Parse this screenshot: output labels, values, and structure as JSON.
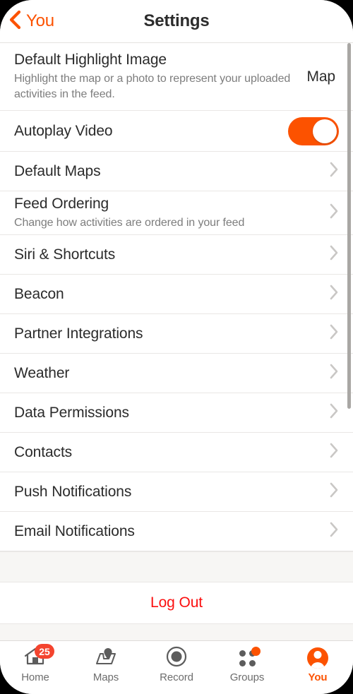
{
  "navbar": {
    "back_label": "You",
    "back_icon": "chevron-left-icon",
    "title": "Settings"
  },
  "colors": {
    "accent_orange": "#fc5200",
    "logout_red": "#fb0f0f",
    "badge_red": "#f4442e",
    "spacer_gray": "#f7f6f4",
    "chevron_gray": "#c9c7c5"
  },
  "settings": {
    "highlight_image": {
      "title": "Default Highlight Image",
      "subtitle": "Highlight the map or a photo to represent your uploaded activities in the feed.",
      "value": "Map"
    },
    "autoplay": {
      "title": "Autoplay Video",
      "toggle_state": "on"
    },
    "rows": [
      {
        "title": "Default Maps"
      },
      {
        "title": "Feed Ordering",
        "subtitle": "Change how activities are ordered in your feed"
      },
      {
        "title": "Siri & Shortcuts"
      },
      {
        "title": "Beacon"
      },
      {
        "title": "Partner Integrations"
      },
      {
        "title": "Weather"
      },
      {
        "title": "Data Permissions"
      },
      {
        "title": "Contacts"
      },
      {
        "title": "Push Notifications"
      },
      {
        "title": "Email Notifications"
      }
    ],
    "logout_label": "Log Out"
  },
  "tabbar": {
    "tabs": [
      {
        "label": "Home",
        "icon": "house-icon",
        "badge": "25",
        "active": false
      },
      {
        "label": "Maps",
        "icon": "map-pin-icon",
        "badge": "",
        "active": false
      },
      {
        "label": "Record",
        "icon": "record-dot-icon",
        "badge": "",
        "active": false
      },
      {
        "label": "Groups",
        "icon": "four-dots-icon",
        "badge": "•",
        "active": false
      },
      {
        "label": "You",
        "icon": "person-avatar-icon",
        "badge": "",
        "active": true
      }
    ]
  }
}
